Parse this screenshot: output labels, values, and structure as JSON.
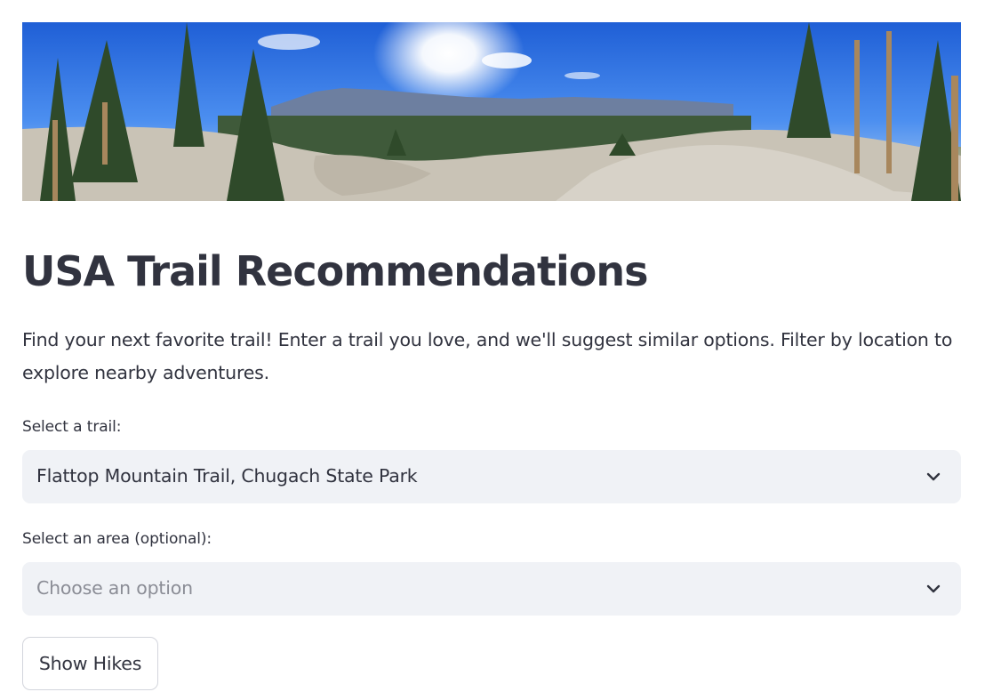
{
  "page": {
    "title": "USA Trail Recommendations",
    "intro": "Find your next favorite trail! Enter a trail you love, and we'll suggest similar options. Filter by location to explore nearby adventures."
  },
  "banner": {
    "description": "banner-image"
  },
  "trail_select": {
    "label": "Select a trail:",
    "value": "Flattop Mountain Trail, Chugach State Park"
  },
  "area_select": {
    "label": "Select an area (optional):",
    "placeholder": "Choose an option"
  },
  "show_button": {
    "label": "Show Hikes"
  },
  "colors": {
    "text": "#31333f",
    "select_bg": "#f0f2f6",
    "placeholder": "#8b8d96",
    "button_border": "#d3d5dc"
  }
}
